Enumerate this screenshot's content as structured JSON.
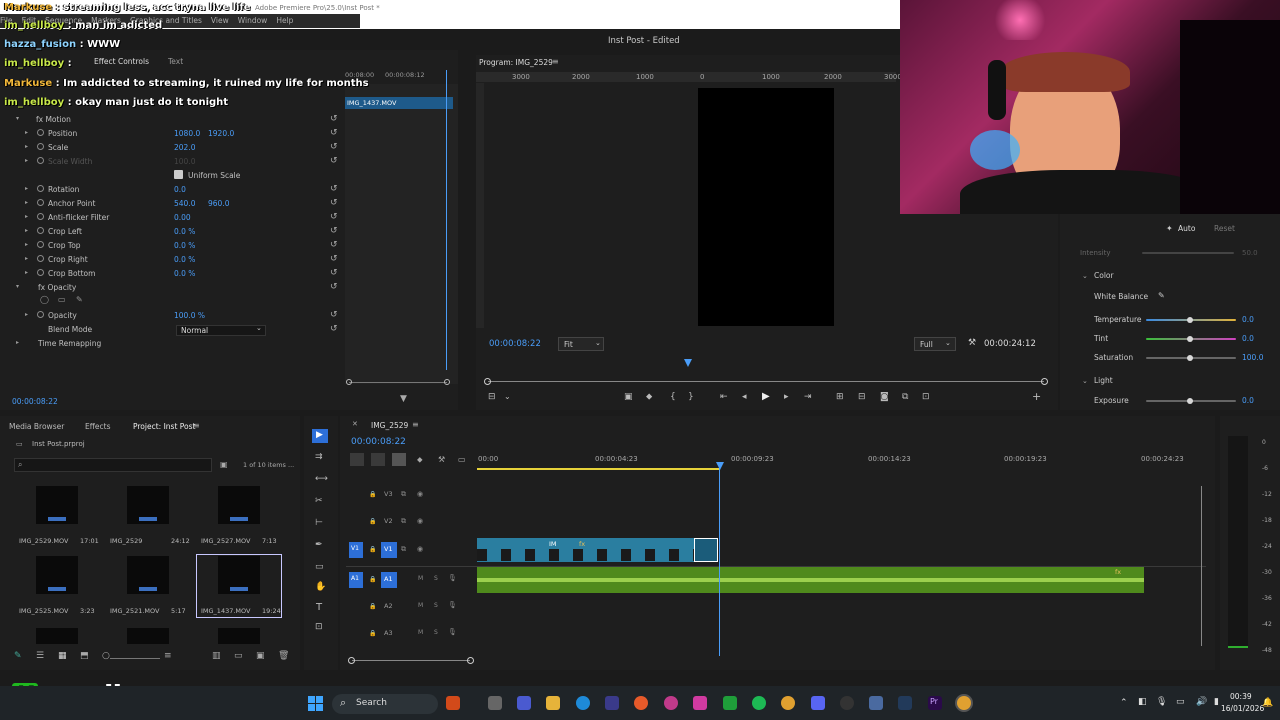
{
  "app": {
    "window_title": "Adobe Premiere Pro\\25.0\\Inst Post *",
    "project_title": "Inst Post - Edited",
    "menu": [
      "File",
      "Edit",
      "Sequence",
      "Markers",
      "Graphics and Titles",
      "View",
      "Window",
      "Help"
    ]
  },
  "chat": [
    {
      "user": "Markuse",
      "msg": ": streaming less, acc tryna live life"
    },
    {
      "user": "im_hellboy",
      "msg": ": man im adicted"
    },
    {
      "user": "hazza_fusion",
      "msg": ": WWW"
    },
    {
      "user": "im_hellboy",
      "msg": ":"
    },
    {
      "user": "Markuse",
      "msg": ": Im addicted to streaming, it ruined my life for months"
    },
    {
      "user": "im_hellboy",
      "msg": ": okay man just do it tonight"
    }
  ],
  "effect_controls": {
    "tabs": [
      "Effect Controls",
      "Text"
    ],
    "clip_name": "IMG_1437.MOV",
    "mini_times": [
      "00:08:00",
      "00:00:08:12"
    ],
    "current_time": "00:00:08:22",
    "rows": [
      {
        "label": "fx  Motion",
        "v1": "",
        "v2": ""
      },
      {
        "label": "Position",
        "v1": "1080.0",
        "v2": "1920.0"
      },
      {
        "label": "Scale",
        "v1": "202.0",
        "v2": ""
      },
      {
        "label": "Scale Width",
        "v1": "100.0",
        "v2": ""
      },
      {
        "label": "Uniform Scale",
        "v1": "",
        "v2": ""
      },
      {
        "label": "Rotation",
        "v1": "0.0",
        "v2": ""
      },
      {
        "label": "Anchor Point",
        "v1": "540.0",
        "v2": "960.0"
      },
      {
        "label": "Anti-flicker Filter",
        "v1": "0.00",
        "v2": ""
      },
      {
        "label": "Crop Left",
        "v1": "0.0 %",
        "v2": ""
      },
      {
        "label": "Crop Top",
        "v1": "0.0 %",
        "v2": ""
      },
      {
        "label": "Crop Right",
        "v1": "0.0 %",
        "v2": ""
      },
      {
        "label": "Crop Bottom",
        "v1": "0.0 %",
        "v2": ""
      },
      {
        "label": "fx  Opacity",
        "v1": "",
        "v2": ""
      },
      {
        "label": "",
        "v1": "",
        "v2": ""
      },
      {
        "label": "Opacity",
        "v1": "100.0 %",
        "v2": ""
      },
      {
        "label": "Blend Mode",
        "v1": "Normal",
        "v2": ""
      },
      {
        "label": "Time Remapping",
        "v1": "",
        "v2": ""
      }
    ]
  },
  "program": {
    "title": "Program: IMG_2529",
    "ruler": [
      "3000",
      "2000",
      "1000",
      "0",
      "1000",
      "2000",
      "3000"
    ],
    "timecode": "00:00:08:22",
    "fit": "Fit",
    "quality": "Full",
    "duration": "00:00:24:12"
  },
  "lumetri": {
    "auto": "Auto",
    "reset": "Reset",
    "intensity": "Intensity",
    "intensity_val": "50.0",
    "section_color": "Color",
    "white_balance": "White Balance",
    "temperature": {
      "label": "Temperature",
      "value": "0.0"
    },
    "tint": {
      "label": "Tint",
      "value": "0.0"
    },
    "saturation": {
      "label": "Saturation",
      "value": "100.0"
    },
    "section_light": "Light",
    "exposure": {
      "label": "Exposure",
      "value": "0.0"
    }
  },
  "project": {
    "tabs": [
      "Media Browser",
      "Effects",
      "Project: Inst Post"
    ],
    "file": "Inst Post.prproj",
    "count": "1 of 10 items ...",
    "items": [
      {
        "name": "IMG_2529.MOV",
        "dur": "17:01"
      },
      {
        "name": "IMG_2529",
        "dur": "24:12"
      },
      {
        "name": "IMG_2527.MOV",
        "dur": "7:13"
      },
      {
        "name": "IMG_2525.MOV",
        "dur": "3:23"
      },
      {
        "name": "IMG_2521.MOV",
        "dur": "5:17"
      },
      {
        "name": "IMG_1437.MOV",
        "dur": "19:24"
      }
    ]
  },
  "timeline": {
    "title": "IMG_2529",
    "timecode": "00:00:08:22",
    "ruler": [
      "00:00",
      "00:00:04:23",
      "00:00:09:23",
      "00:00:14:23",
      "00:00:19:23",
      "00:00:24:23"
    ],
    "tracks": [
      {
        "id": "V3",
        "kind": "video"
      },
      {
        "id": "V2",
        "kind": "video"
      },
      {
        "id": "V1",
        "kind": "video"
      },
      {
        "id": "A1",
        "kind": "audio"
      },
      {
        "id": "A2",
        "kind": "audio"
      },
      {
        "id": "A3",
        "kind": "audio"
      }
    ],
    "clip_label": "IM",
    "meter_labels": [
      "0",
      "-6",
      "-12",
      "-18",
      "-24",
      "-30",
      "-36",
      "-42",
      "-48"
    ]
  },
  "watermark": "marlizzy",
  "taskbar": {
    "search": "Search",
    "time": "00:39",
    "date": "16/01/2026"
  }
}
